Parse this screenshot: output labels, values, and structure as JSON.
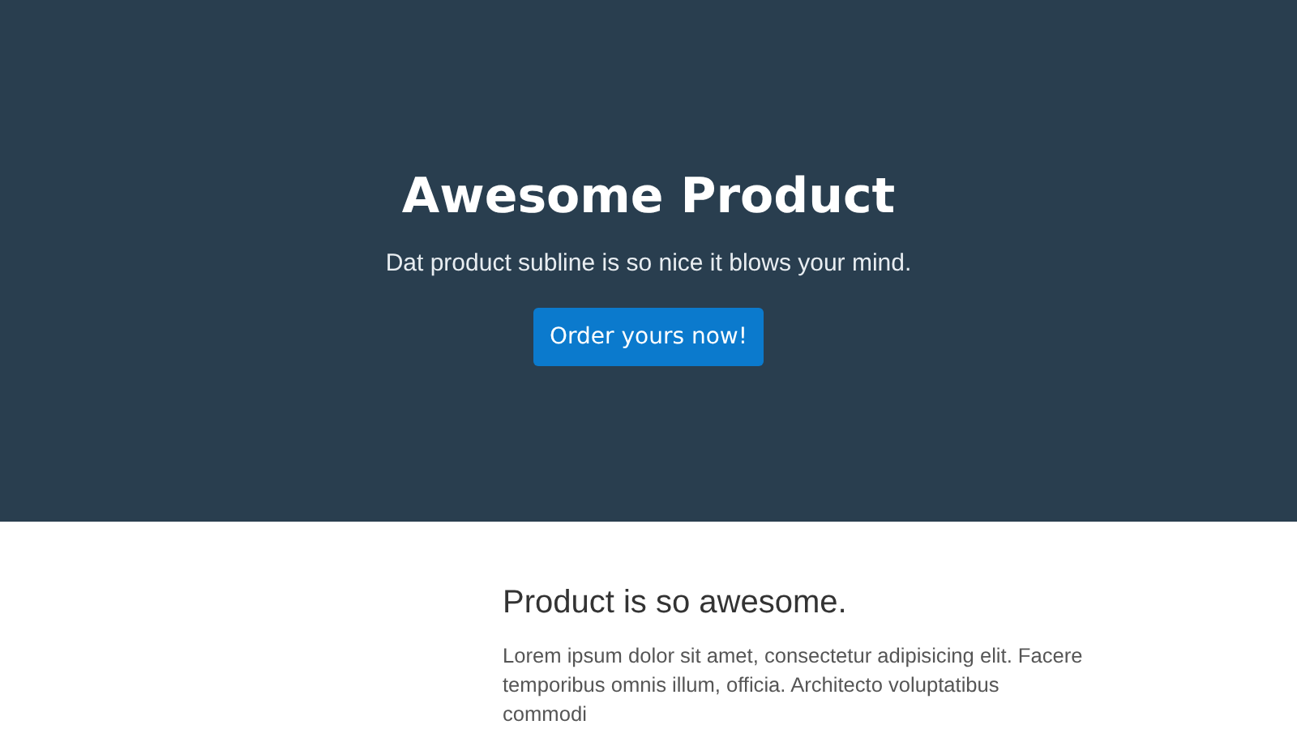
{
  "hero": {
    "title": "Awesome Product",
    "subline": "Dat product subline is so nice it blows your mind.",
    "button": "Order yours now!"
  },
  "section": {
    "heading": "Product is so awesome.",
    "paragraph": "Lorem ipsum dolor sit amet, consectetur adipisicing elit. Facere temporibus omnis illum, officia. Architecto voluptatibus commodi"
  }
}
